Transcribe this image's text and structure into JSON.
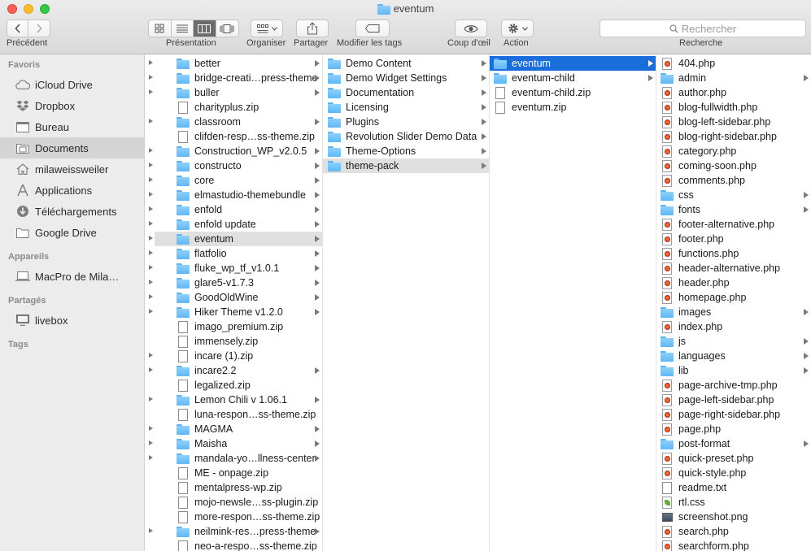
{
  "window": {
    "title": "eventum",
    "title_icon": "folder-icon",
    "traffic_lights": {
      "close": "#fc5f57",
      "minimize": "#fdbc2e",
      "zoom": "#33c748"
    }
  },
  "toolbar": {
    "back_label": "Précédent",
    "view_label": "Présentation",
    "arrange_label": "Organiser",
    "share_label": "Partager",
    "tags_label": "Modifier les tags",
    "quicklook_label": "Coup d'œil",
    "action_label": "Action",
    "search_label": "Recherche",
    "search_placeholder": "Rechercher",
    "active_view": "columns"
  },
  "sidebar": {
    "sections": [
      {
        "label": "Favoris",
        "items": [
          {
            "label": "iCloud Drive",
            "icon": "cloud-icon"
          },
          {
            "label": "Dropbox",
            "icon": "dropbox-icon"
          },
          {
            "label": "Bureau",
            "icon": "desktop-icon"
          },
          {
            "label": "Documents",
            "icon": "documents-folder-icon",
            "selected": true
          },
          {
            "label": "milaweissweiler",
            "icon": "home-icon"
          },
          {
            "label": "Applications",
            "icon": "applications-icon"
          },
          {
            "label": "Téléchargements",
            "icon": "downloads-icon"
          },
          {
            "label": "Google Drive",
            "icon": "folder-icon"
          }
        ]
      },
      {
        "label": "Appareils",
        "items": [
          {
            "label": "MacPro de Mila…",
            "icon": "laptop-icon"
          }
        ]
      },
      {
        "label": "Partagés",
        "items": [
          {
            "label": "livebox",
            "icon": "monitor-icon"
          }
        ]
      },
      {
        "label": "Tags",
        "items": []
      }
    ]
  },
  "columns": [
    {
      "items": [
        {
          "name": "better",
          "kind": "folder"
        },
        {
          "name": "bridge-creati…press-theme",
          "kind": "folder"
        },
        {
          "name": "buller",
          "kind": "folder"
        },
        {
          "name": "charityplus.zip",
          "kind": "zip"
        },
        {
          "name": "classroom",
          "kind": "folder"
        },
        {
          "name": "clifden-resp…ss-theme.zip",
          "kind": "zip"
        },
        {
          "name": "Construction_WP_v2.0.5",
          "kind": "folder"
        },
        {
          "name": "constructo",
          "kind": "folder"
        },
        {
          "name": "core",
          "kind": "folder"
        },
        {
          "name": "elmastudio-themebundle",
          "kind": "folder"
        },
        {
          "name": "enfold",
          "kind": "folder"
        },
        {
          "name": "enfold update",
          "kind": "folder"
        },
        {
          "name": "eventum",
          "kind": "folder",
          "state": "selected"
        },
        {
          "name": "flatfolio",
          "kind": "folder"
        },
        {
          "name": "fluke_wp_tf_v1.0.1",
          "kind": "folder"
        },
        {
          "name": "glare5-v1.7.3",
          "kind": "folder"
        },
        {
          "name": "GoodOldWine",
          "kind": "folder"
        },
        {
          "name": "Hiker Theme v1.2.0",
          "kind": "folder"
        },
        {
          "name": "imago_premium.zip",
          "kind": "zip"
        },
        {
          "name": "immensely.zip",
          "kind": "zip"
        },
        {
          "name": "incare (1).zip",
          "kind": "zip"
        },
        {
          "name": "incare2.2",
          "kind": "folder"
        },
        {
          "name": "legalized.zip",
          "kind": "zip"
        },
        {
          "name": "Lemon Chili v 1.06.1",
          "kind": "folder"
        },
        {
          "name": "luna-respon…ss-theme.zip",
          "kind": "zip"
        },
        {
          "name": "MAGMA",
          "kind": "folder"
        },
        {
          "name": "Maisha",
          "kind": "folder"
        },
        {
          "name": "mandala-yo…llness-center",
          "kind": "folder"
        },
        {
          "name": "ME - onpage.zip",
          "kind": "zip"
        },
        {
          "name": "mentalpress-wp.zip",
          "kind": "zip"
        },
        {
          "name": "mojo-newsle…ss-plugin.zip",
          "kind": "zip"
        },
        {
          "name": "more-respon…ss-theme.zip",
          "kind": "zip"
        },
        {
          "name": "neilmink-res…press-theme",
          "kind": "folder"
        },
        {
          "name": "neo-a-respo…ss-theme.zip",
          "kind": "zip"
        }
      ]
    },
    {
      "items": [
        {
          "name": "Demo Content",
          "kind": "folder"
        },
        {
          "name": "Demo Widget Settings",
          "kind": "folder"
        },
        {
          "name": "Documentation",
          "kind": "folder"
        },
        {
          "name": "Licensing",
          "kind": "folder"
        },
        {
          "name": "Plugins",
          "kind": "folder"
        },
        {
          "name": "Revolution Slider Demo Data",
          "kind": "folder"
        },
        {
          "name": "Theme-Options",
          "kind": "folder"
        },
        {
          "name": "theme-pack",
          "kind": "folder",
          "state": "selected"
        }
      ]
    },
    {
      "items": [
        {
          "name": "eventum",
          "kind": "folder",
          "state": "active"
        },
        {
          "name": "eventum-child",
          "kind": "folder"
        },
        {
          "name": "eventum-child.zip",
          "kind": "zip"
        },
        {
          "name": "eventum.zip",
          "kind": "zip"
        }
      ]
    },
    {
      "items": [
        {
          "name": "404.php",
          "kind": "php"
        },
        {
          "name": "admin",
          "kind": "folder"
        },
        {
          "name": "author.php",
          "kind": "php"
        },
        {
          "name": "blog-fullwidth.php",
          "kind": "php"
        },
        {
          "name": "blog-left-sidebar.php",
          "kind": "php"
        },
        {
          "name": "blog-right-sidebar.php",
          "kind": "php"
        },
        {
          "name": "category.php",
          "kind": "php"
        },
        {
          "name": "coming-soon.php",
          "kind": "php"
        },
        {
          "name": "comments.php",
          "kind": "php"
        },
        {
          "name": "css",
          "kind": "folder"
        },
        {
          "name": "fonts",
          "kind": "folder"
        },
        {
          "name": "footer-alternative.php",
          "kind": "php"
        },
        {
          "name": "footer.php",
          "kind": "php"
        },
        {
          "name": "functions.php",
          "kind": "php"
        },
        {
          "name": "header-alternative.php",
          "kind": "php"
        },
        {
          "name": "header.php",
          "kind": "php"
        },
        {
          "name": "homepage.php",
          "kind": "php"
        },
        {
          "name": "images",
          "kind": "folder"
        },
        {
          "name": "index.php",
          "kind": "php"
        },
        {
          "name": "js",
          "kind": "folder"
        },
        {
          "name": "languages",
          "kind": "folder"
        },
        {
          "name": "lib",
          "kind": "folder"
        },
        {
          "name": "page-archive-tmp.php",
          "kind": "php"
        },
        {
          "name": "page-left-sidebar.php",
          "kind": "php"
        },
        {
          "name": "page-right-sidebar.php",
          "kind": "php"
        },
        {
          "name": "page.php",
          "kind": "php"
        },
        {
          "name": "post-format",
          "kind": "folder"
        },
        {
          "name": "quick-preset.php",
          "kind": "php"
        },
        {
          "name": "quick-style.php",
          "kind": "php"
        },
        {
          "name": "readme.txt",
          "kind": "txt"
        },
        {
          "name": "rtl.css",
          "kind": "css"
        },
        {
          "name": "screenshot.png",
          "kind": "image"
        },
        {
          "name": "search.php",
          "kind": "php"
        },
        {
          "name": "searchform.php",
          "kind": "php"
        }
      ]
    }
  ],
  "colors": {
    "selection_active": "#1a6edb",
    "selection_inactive": "#e0e0e0",
    "folder": "#5fb7f5",
    "sidebar_bg": "#ececec"
  }
}
